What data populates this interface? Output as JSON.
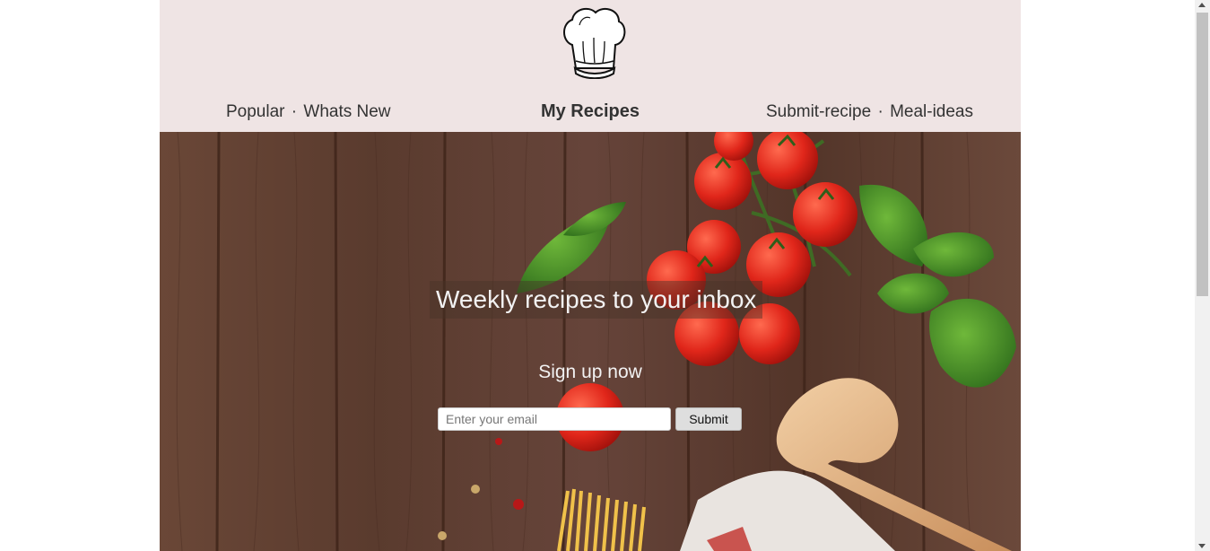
{
  "header": {
    "logo_icon": "chef-hat-icon",
    "brand": "My Recipes",
    "nav_left": [
      "Popular",
      "Whats New"
    ],
    "nav_right": [
      "Submit-recipe",
      "Meal-ideas"
    ],
    "separator": "·"
  },
  "hero": {
    "headline": "Weekly recipes to your inbox",
    "signup_title": "Sign up now",
    "email_placeholder": "Enter your email",
    "submit_label": "Submit"
  },
  "colors": {
    "header_bg": "#efe4e4",
    "wood": "#5b3b2e",
    "nav_text": "#333333"
  }
}
